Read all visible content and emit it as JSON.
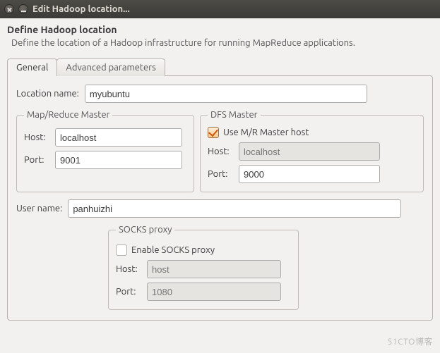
{
  "window": {
    "title": "Edit Hadoop location..."
  },
  "header": {
    "title": "Define Hadoop location",
    "description": "Define the location of a Hadoop infrastructure for running MapReduce applications."
  },
  "tabs": {
    "general": "General",
    "advanced": "Advanced parameters"
  },
  "general": {
    "location_name_label": "Location name:",
    "location_name": "myubuntu",
    "mr_master": {
      "legend": "Map/Reduce Master",
      "host_label": "Host:",
      "host": "localhost",
      "port_label": "Port:",
      "port": "9001"
    },
    "dfs_master": {
      "legend": "DFS Master",
      "use_mr_label": "Use M/R Master host",
      "use_mr_checked": true,
      "host_label": "Host:",
      "host_placeholder": "localhost",
      "port_label": "Port:",
      "port": "9000"
    },
    "user_name_label": "User name:",
    "user_name": "panhuizhi",
    "socks": {
      "legend": "SOCKS proxy",
      "enable_label": "Enable SOCKS proxy",
      "enable_checked": false,
      "host_label": "Host:",
      "host_placeholder": "host",
      "port_label": "Port:",
      "port_placeholder": "1080"
    }
  },
  "watermark": "51CTO博客"
}
